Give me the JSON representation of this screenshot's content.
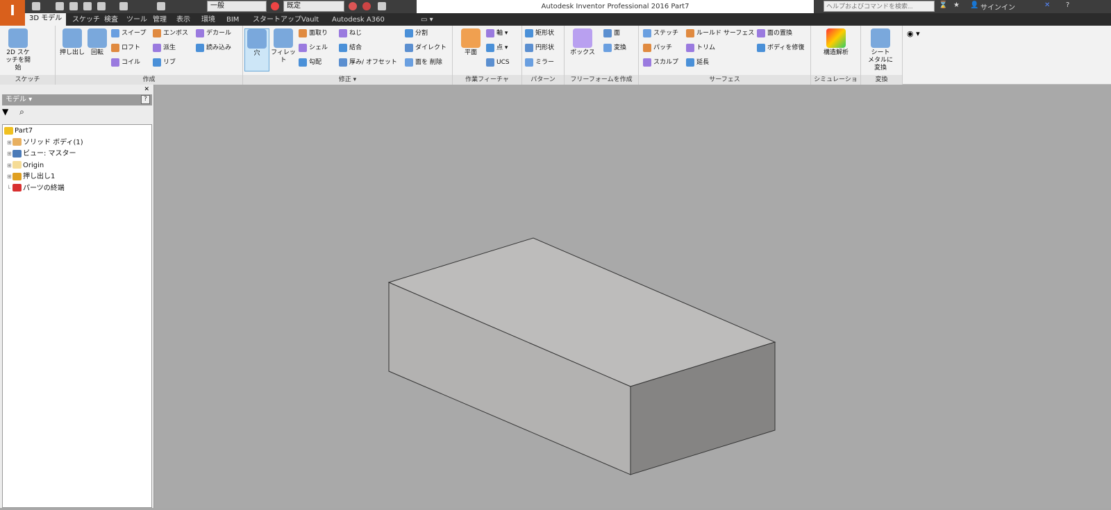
{
  "title": "Autodesk Inventor Professional 2016   Part7",
  "app_button": "I",
  "quick_access": {
    "appearance_combo": "一般",
    "material_combo": "既定"
  },
  "search": {
    "placeholder": "ヘルプおよびコマンドを検索..."
  },
  "sign_in": "サインイン",
  "tabs": [
    "3D モデル",
    "スケッチ",
    "検査",
    "ツール",
    "管理",
    "表示",
    "環境",
    "BIM",
    "スタートアップ",
    "Vault",
    "Autodesk A360"
  ],
  "active_tab": "3D モデル",
  "ribbon": {
    "groups": [
      {
        "label": "スケッチ",
        "large": [
          "2D スケッチを開始"
        ],
        "cols": []
      },
      {
        "label": "作成",
        "large": [
          "押し出し",
          "回転"
        ],
        "cols": [
          [
            "スイープ",
            "ロフト",
            "コイル"
          ],
          [
            "エンボス",
            "派生",
            "リブ"
          ],
          [
            "デカール",
            "読み込み"
          ]
        ]
      },
      {
        "label": "修正 ▾",
        "large": [
          "穴",
          "フィレット"
        ],
        "cols": [
          [
            "面取り",
            "シェル",
            "勾配"
          ],
          [
            "ねじ",
            "結合",
            "厚み/ オフセット"
          ],
          [
            "分割",
            "ダイレクト",
            "面を 削除"
          ]
        ]
      },
      {
        "label": "作業フィーチャ",
        "large": [
          "平面"
        ],
        "cols": [
          [
            "軸 ▾",
            "点 ▾",
            "UCS"
          ]
        ]
      },
      {
        "label": "パターン",
        "large": [],
        "cols": [
          [
            "矩形状",
            "円形状",
            "ミラー"
          ]
        ]
      },
      {
        "label": "フリーフォームを作成",
        "large": [
          "ボックス"
        ],
        "cols": [
          [
            "面",
            "変換"
          ]
        ]
      },
      {
        "label": "サーフェス",
        "large": [],
        "cols": [
          [
            "ステッチ",
            "パッチ",
            "スカルプ"
          ],
          [
            "ルールド サーフェス",
            "トリム",
            "延長"
          ],
          [
            "面の置換",
            "ボディを修復"
          ]
        ]
      },
      {
        "label": "シミュレーション",
        "large": [
          "構造解析"
        ],
        "cols": []
      },
      {
        "label": "変換",
        "large": [
          "シート メタルに変換"
        ],
        "cols": []
      }
    ],
    "selected": "穴"
  },
  "browser": {
    "header": "モデル ▾",
    "tree": [
      {
        "label": "Part7",
        "icon": "part-icon",
        "color": "#f0c020"
      },
      {
        "label": "ソリッド ボディ(1)",
        "icon": "solid-body-icon",
        "color": "#e8b060"
      },
      {
        "label": "ビュー: マスター",
        "icon": "view-icon",
        "color": "#4a7ab8"
      },
      {
        "label": "Origin",
        "icon": "folder-icon",
        "color": "#f5dc96"
      },
      {
        "label": "押し出し1",
        "icon": "extrude-icon",
        "color": "#e0a020"
      },
      {
        "label": "パーツの終端",
        "icon": "end-of-part-icon",
        "color": "#d83030"
      }
    ]
  },
  "colors": {
    "box_top": "#bdbcbb",
    "box_front": "#b3b2b1",
    "box_side": "#858483",
    "viewport": "#a9a9a9",
    "accent": "#d9601c"
  }
}
